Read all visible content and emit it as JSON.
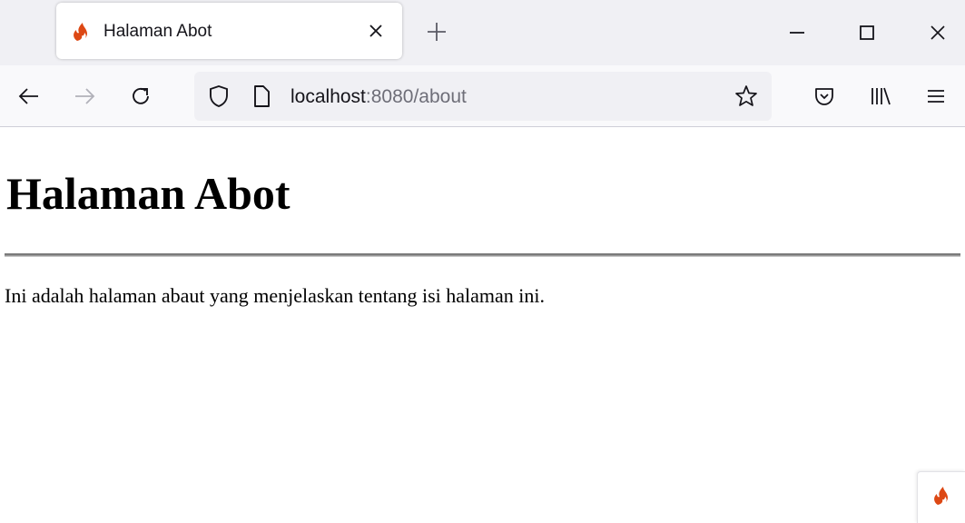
{
  "browser": {
    "tab": {
      "title": "Halaman Abot",
      "favicon": "codeigniter-flame-icon"
    },
    "url": {
      "host": "localhost",
      "rest": ":8080/about"
    },
    "icons": {
      "back": "arrow-left-icon",
      "forward": "arrow-right-icon",
      "reload": "reload-icon",
      "shield": "shield-icon",
      "page": "page-icon",
      "bookmark": "star-icon",
      "pocket": "pocket-icon",
      "library": "library-icon",
      "menu": "hamburger-menu-icon"
    }
  },
  "page": {
    "heading": "Halaman Abot",
    "body": "Ini adalah halaman abaut yang menjelaskan tentang isi halaman ini."
  },
  "colors": {
    "accent_flame": "#dd4814",
    "tabstrip_bg": "#f0f0f4",
    "navbar_bg": "#f9f9fb"
  }
}
